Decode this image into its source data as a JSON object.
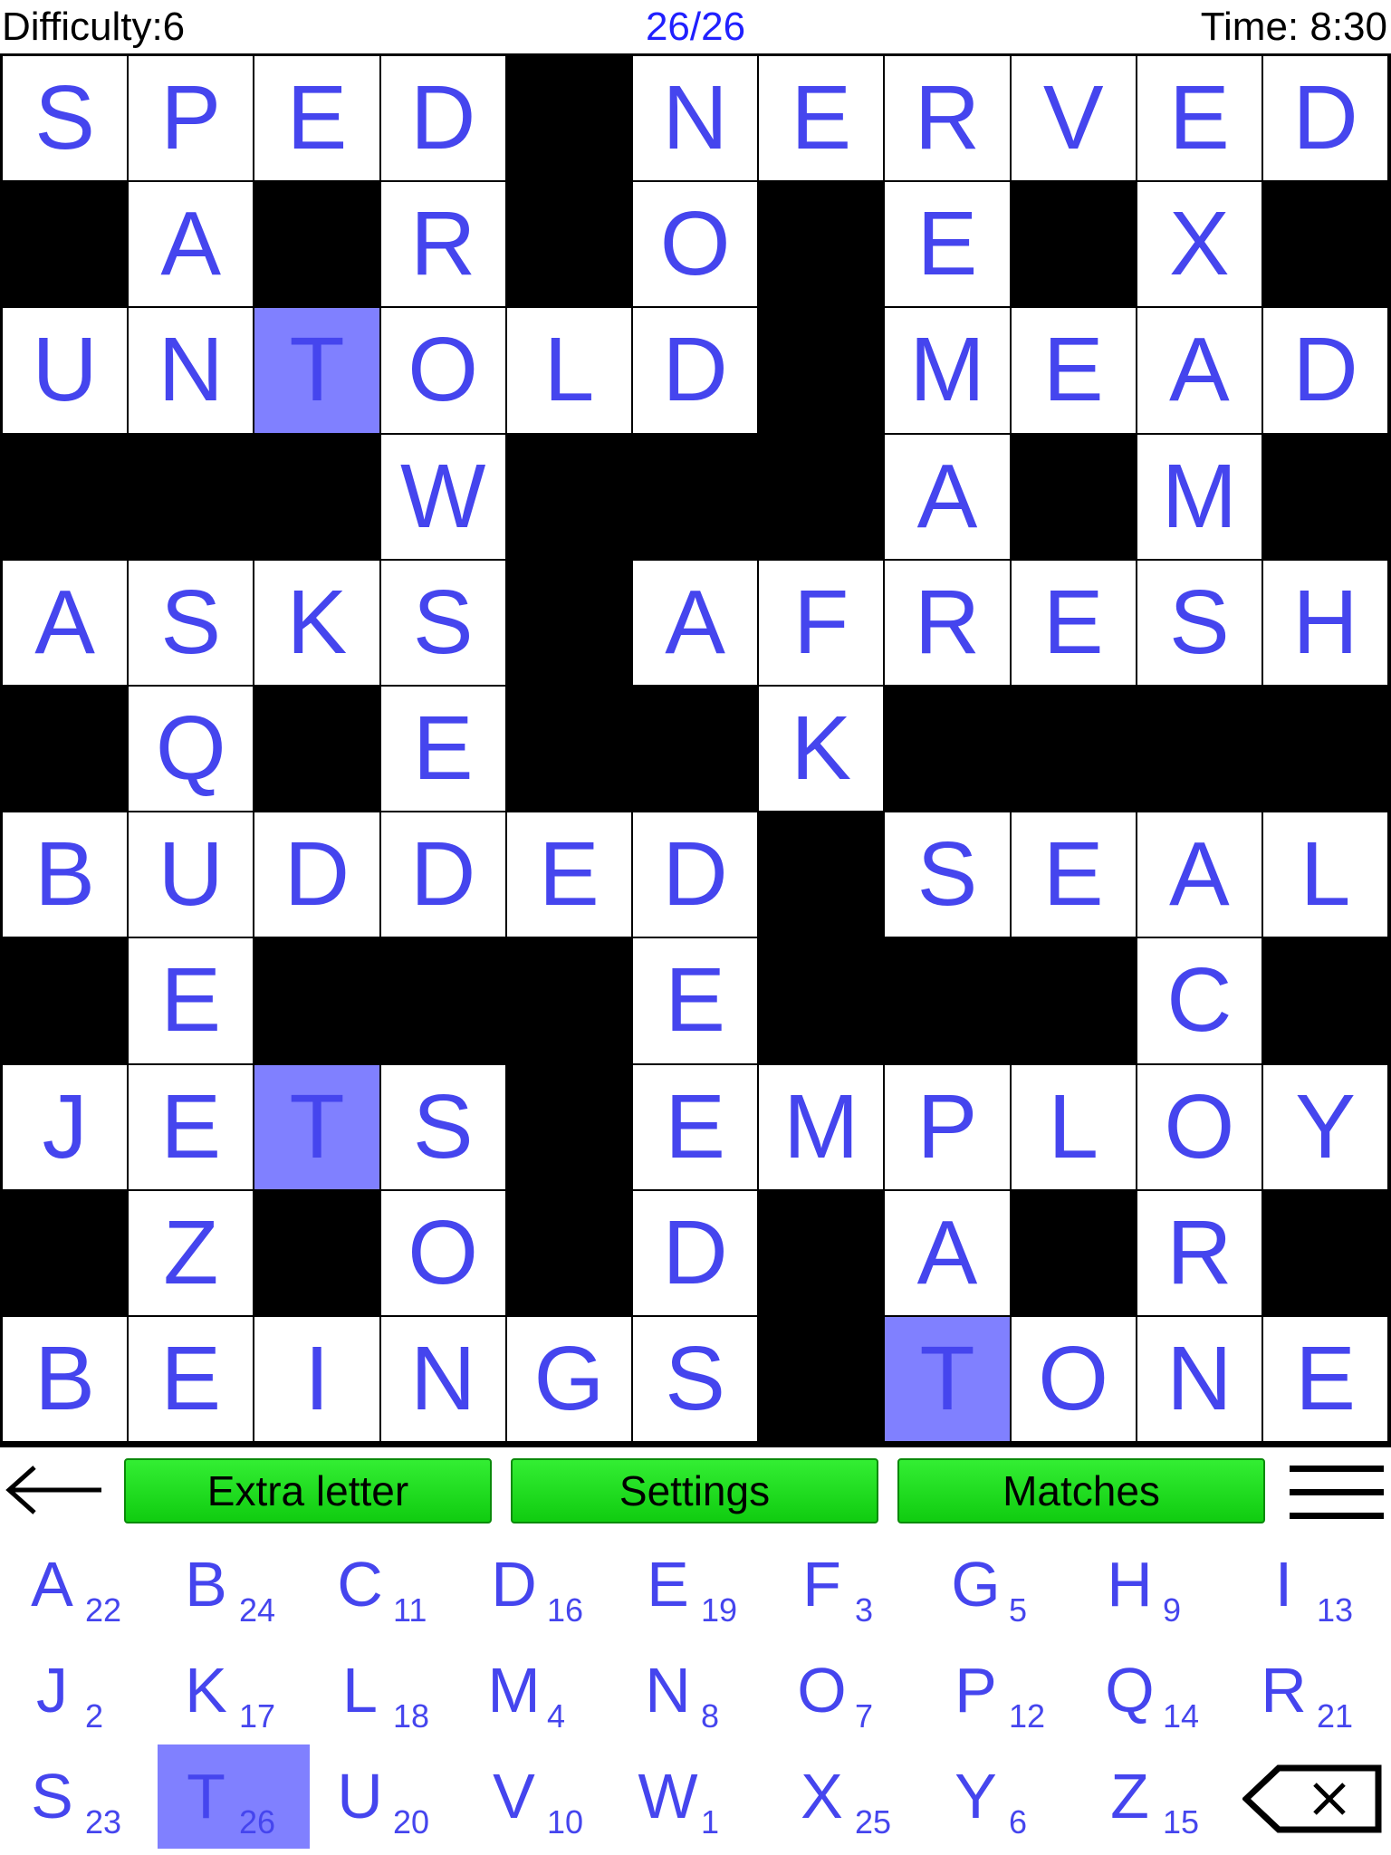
{
  "header": {
    "difficulty": "Difficulty:6",
    "progress": "26/26",
    "time": "Time: 8:30"
  },
  "grid": {
    "rows": [
      "SPED#NERVED",
      "#A#R#O#E#X#",
      "UNTOLD#MEAD",
      "###W###A#M#",
      "ASKS#AFRESH",
      "#Q#E##K####",
      "BUDDED#SEAL",
      "#E###E###C#",
      "JETS#EMPLOY",
      "#Z#O#D#A#R#",
      "BEINGS#TONE"
    ],
    "highlighted_cells": [
      [
        2,
        2
      ],
      [
        8,
        2
      ],
      [
        10,
        7
      ]
    ],
    "letter_color": "#4545ee",
    "highlight_color": "#8080ff"
  },
  "toolbar": {
    "extra_letter": "Extra letter",
    "settings": "Settings",
    "matches": "Matches",
    "button_color": "#22dd22"
  },
  "keyboard": {
    "keys": [
      {
        "letter": "A",
        "count": "22"
      },
      {
        "letter": "B",
        "count": "24"
      },
      {
        "letter": "C",
        "count": "11"
      },
      {
        "letter": "D",
        "count": "16"
      },
      {
        "letter": "E",
        "count": "19"
      },
      {
        "letter": "F",
        "count": "3"
      },
      {
        "letter": "G",
        "count": "5"
      },
      {
        "letter": "H",
        "count": "9"
      },
      {
        "letter": "I",
        "count": "13"
      },
      {
        "letter": "J",
        "count": "2"
      },
      {
        "letter": "K",
        "count": "17"
      },
      {
        "letter": "L",
        "count": "18"
      },
      {
        "letter": "M",
        "count": "4"
      },
      {
        "letter": "N",
        "count": "8"
      },
      {
        "letter": "O",
        "count": "7"
      },
      {
        "letter": "P",
        "count": "12"
      },
      {
        "letter": "Q",
        "count": "14"
      },
      {
        "letter": "R",
        "count": "21"
      },
      {
        "letter": "S",
        "count": "23"
      },
      {
        "letter": "T",
        "count": "26",
        "selected": true
      },
      {
        "letter": "U",
        "count": "20"
      },
      {
        "letter": "V",
        "count": "10"
      },
      {
        "letter": "W",
        "count": "1"
      },
      {
        "letter": "X",
        "count": "25"
      },
      {
        "letter": "Y",
        "count": "6"
      },
      {
        "letter": "Z",
        "count": "15"
      }
    ],
    "icons": {
      "back": "arrow-left-icon",
      "menu": "hamburger-menu-icon",
      "backspace": "backspace-icon"
    }
  }
}
